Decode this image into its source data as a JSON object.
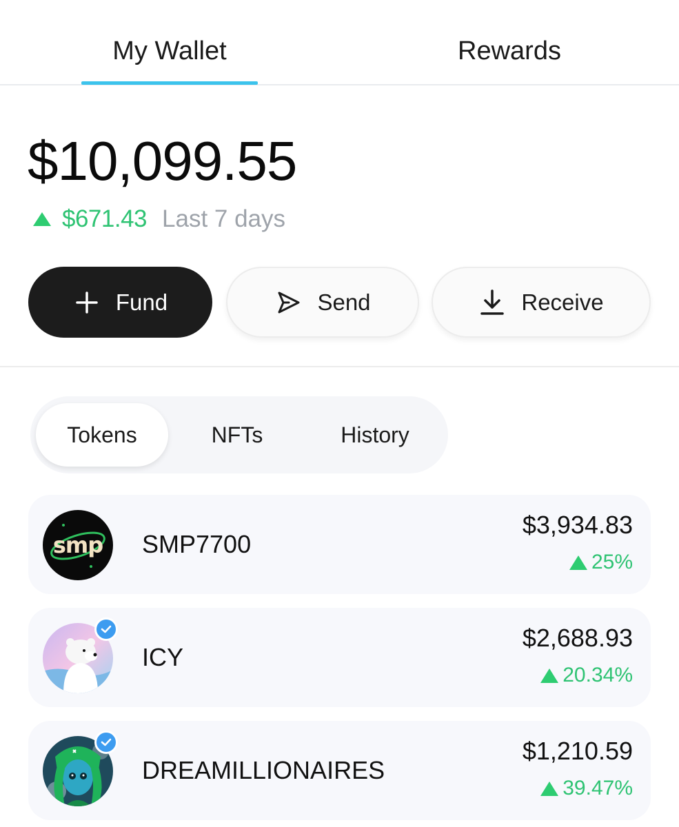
{
  "top_tabs": [
    {
      "label": "My Wallet",
      "active": true
    },
    {
      "label": "Rewards",
      "active": false
    }
  ],
  "accent_color": "#3cc3ec",
  "positive_color": "#2fc373",
  "balance": {
    "amount": "$10,099.55",
    "change": "$671.43",
    "period": "Last 7 days",
    "direction": "up"
  },
  "actions": {
    "fund": {
      "label": "Fund",
      "icon": "plus-icon"
    },
    "send": {
      "label": "Send",
      "icon": "send-arrow-icon"
    },
    "receive": {
      "label": "Receive",
      "icon": "download-icon"
    }
  },
  "segments": [
    {
      "label": "Tokens",
      "active": true
    },
    {
      "label": "NFTs",
      "active": false
    },
    {
      "label": "History",
      "active": false
    }
  ],
  "tokens": [
    {
      "name": "SMP7700",
      "value": "$3,934.83",
      "change": "25%",
      "logo_text": "smp",
      "verified": false,
      "avatar_icon": "smp-logo"
    },
    {
      "name": "ICY",
      "value": "$2,688.93",
      "change": "20.34%",
      "verified": true,
      "avatar_icon": "polar-bear-avatar"
    },
    {
      "name": "DREAMILLIONAIRES",
      "value": "$1,210.59",
      "change": "39.47%",
      "verified": true,
      "avatar_icon": "green-character-avatar"
    }
  ]
}
